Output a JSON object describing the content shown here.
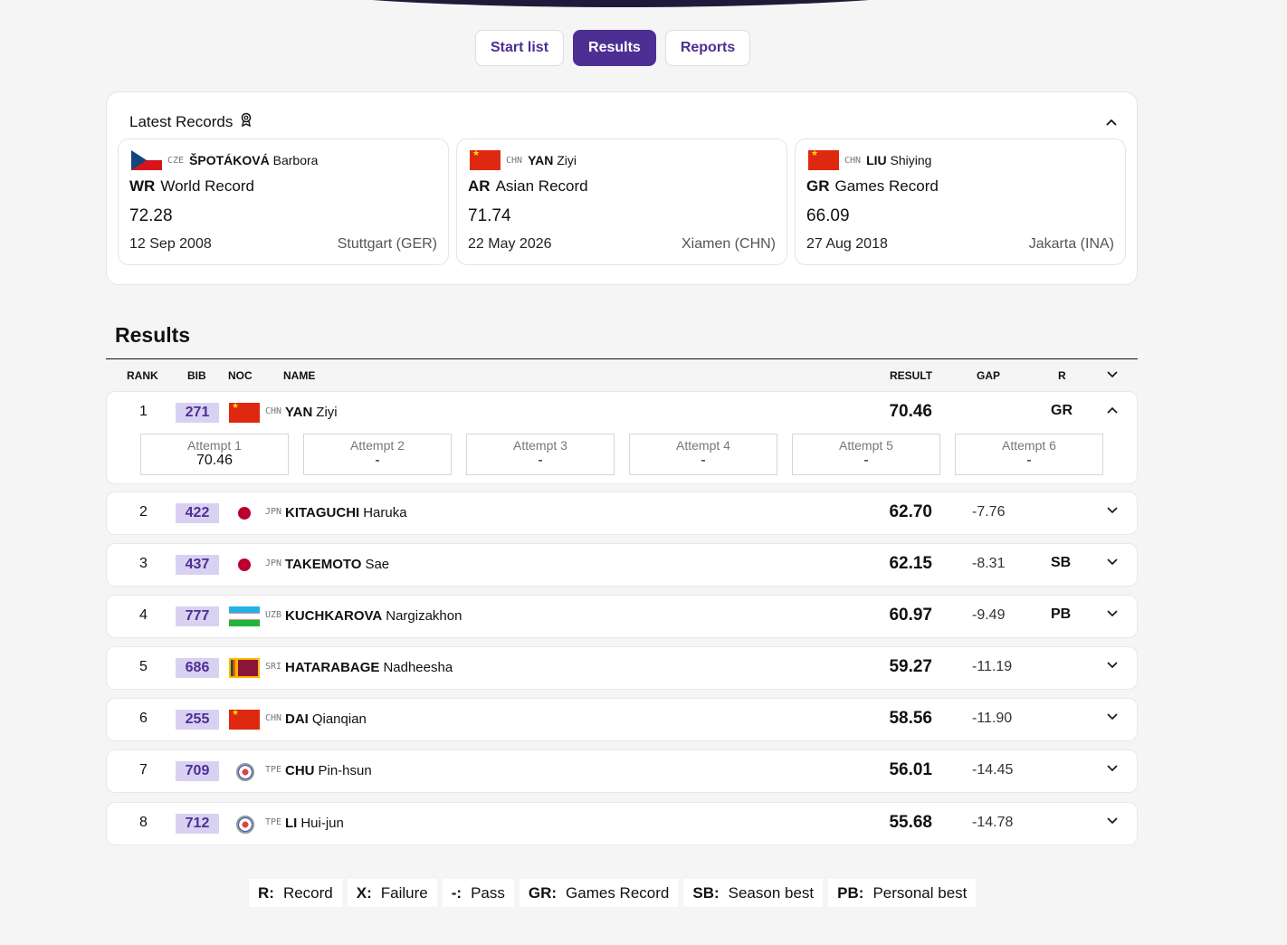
{
  "tabs": [
    {
      "label": "Start list",
      "active": false
    },
    {
      "label": "Results",
      "active": true
    },
    {
      "label": "Reports",
      "active": false
    }
  ],
  "records": {
    "title": "Latest Records",
    "title_icon": "award-ribbon-icon",
    "collapse_icon": "chevron-up-icon",
    "items": [
      {
        "noc": "CZE",
        "flag": "cze",
        "surname": "ŠPOTÁKOVÁ",
        "given": "Barbora",
        "code": "WR",
        "type": "World Record",
        "value": "72.28",
        "date": "12 Sep 2008",
        "place": "Stuttgart (GER)"
      },
      {
        "noc": "CHN",
        "flag": "chn",
        "surname": "YAN",
        "given": "Ziyi",
        "code": "AR",
        "type": "Asian Record",
        "value": "71.74",
        "date": "22 May 2026",
        "place": "Xiamen (CHN)"
      },
      {
        "noc": "CHN",
        "flag": "chn",
        "surname": "LIU",
        "given": "Shiying",
        "code": "GR",
        "type": "Games Record",
        "value": "66.09",
        "date": "27 Aug 2018",
        "place": "Jakarta (INA)"
      }
    ]
  },
  "results": {
    "title": "Results",
    "columns": {
      "rank": "RANK",
      "bib": "BIB",
      "noc": "NOC",
      "name": "NAME",
      "result": "RESULT",
      "gap": "GAP",
      "r": "R"
    },
    "rows": [
      {
        "rank": "1",
        "bib": "271",
        "noc": "CHN",
        "flag": "chn",
        "surname": "YAN",
        "given": "Ziyi",
        "result": "70.46",
        "gap": "",
        "r": "GR",
        "expanded": true,
        "attempts": [
          {
            "label": "Attempt 1",
            "value": "70.46"
          },
          {
            "label": "Attempt 2",
            "value": "-"
          },
          {
            "label": "Attempt 3",
            "value": "-"
          },
          {
            "label": "Attempt 4",
            "value": "-"
          },
          {
            "label": "Attempt 5",
            "value": "-"
          },
          {
            "label": "Attempt 6",
            "value": "-"
          }
        ]
      },
      {
        "rank": "2",
        "bib": "422",
        "noc": "JPN",
        "flag": "jpn",
        "surname": "KITAGUCHI",
        "given": "Haruka",
        "result": "62.70",
        "gap": "-7.76",
        "r": ""
      },
      {
        "rank": "3",
        "bib": "437",
        "noc": "JPN",
        "flag": "jpn",
        "surname": "TAKEMOTO",
        "given": "Sae",
        "result": "62.15",
        "gap": "-8.31",
        "r": "SB"
      },
      {
        "rank": "4",
        "bib": "777",
        "noc": "UZB",
        "flag": "uzb",
        "surname": "KUCHKAROVA",
        "given": "Nargizakhon",
        "result": "60.97",
        "gap": "-9.49",
        "r": "PB"
      },
      {
        "rank": "5",
        "bib": "686",
        "noc": "SRI",
        "flag": "sri",
        "surname": "HATARABAGE",
        "given": "Nadheesha",
        "result": "59.27",
        "gap": "-11.19",
        "r": ""
      },
      {
        "rank": "6",
        "bib": "255",
        "noc": "CHN",
        "flag": "chn",
        "surname": "DAI",
        "given": "Qianqian",
        "result": "58.56",
        "gap": "-11.90",
        "r": ""
      },
      {
        "rank": "7",
        "bib": "709",
        "noc": "TPE",
        "flag": "tpe",
        "surname": "CHU",
        "given": "Pin-hsun",
        "result": "56.01",
        "gap": "-14.45",
        "r": ""
      },
      {
        "rank": "8",
        "bib": "712",
        "noc": "TPE",
        "flag": "tpe",
        "surname": "LI",
        "given": "Hui-jun",
        "result": "55.68",
        "gap": "-14.78",
        "r": ""
      }
    ]
  },
  "legend": [
    {
      "key": "R:",
      "label": "Record"
    },
    {
      "key": "X:",
      "label": "Failure"
    },
    {
      "key": "-:",
      "label": "Pass"
    },
    {
      "key": "GR:",
      "label": "Games Record"
    },
    {
      "key": "SB:",
      "label": "Season best"
    },
    {
      "key": "PB:",
      "label": "Personal best"
    }
  ],
  "colors": {
    "accent": "#4d2f93",
    "bib_bg": "#d9d1f2"
  }
}
